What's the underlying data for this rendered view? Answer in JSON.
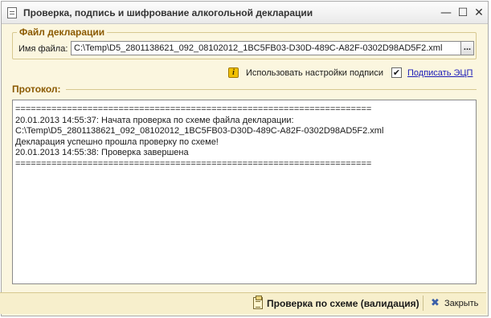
{
  "window": {
    "title": "Проверка, подпись и шифрование алкогольной декларации",
    "minimize_glyph": "—",
    "maximize_glyph": "☐",
    "close_glyph": "✕"
  },
  "declaration_file": {
    "legend": "Файл декларации",
    "label": "Имя файла:",
    "value": "C:\\Temp\\D5_2801138621_092_08102012_1BC5FB03-D30D-489C-A82F-0302D98AD5F2.xml",
    "browse_label": "..."
  },
  "signature": {
    "info_icon_glyph": "i",
    "use_settings_label": "Использовать настройки подписи",
    "checkbox_checked": true,
    "checkbox_glyph": "✔",
    "sign_link": "Подписать ЭЦП"
  },
  "protocol": {
    "label": "Протокол:",
    "lines": [
      "=====================================================================",
      "20.01.2013 14:55:37: Начата проверка по схеме файла декларации:",
      "C:\\Temp\\D5_2801138621_092_08102012_1BC5FB03-D30D-489C-A82F-0302D98AD5F2.xml",
      "Декларация успешно прошла проверку по схеме!",
      "20.01.2013 14:55:38: Проверка завершена",
      "====================================================================="
    ]
  },
  "footer": {
    "validate_label": "Проверка по схеме (валидация)",
    "close_glyph": "✖",
    "close_label": "Закрыть"
  }
}
